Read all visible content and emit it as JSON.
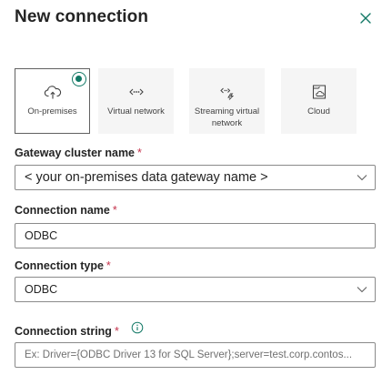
{
  "header": {
    "title": "New connection"
  },
  "tiles": [
    {
      "label": "On-premises",
      "icon": "cloud-upload-icon",
      "selected": true
    },
    {
      "label": "Virtual network",
      "icon": "virtual-network-icon",
      "selected": false
    },
    {
      "label": "Streaming virtual network",
      "icon": "streaming-network-icon",
      "selected": false
    },
    {
      "label": "Cloud",
      "icon": "cloud-report-icon",
      "selected": false
    }
  ],
  "form": {
    "gateway": {
      "label": "Gateway cluster name",
      "required": "*",
      "value": "< your on-premises data gateway name >"
    },
    "connection_name": {
      "label": "Connection name",
      "required": "*",
      "value": "ODBC"
    },
    "connection_type": {
      "label": "Connection type",
      "required": "*",
      "value": "ODBC"
    },
    "connection_string": {
      "label": "Connection string",
      "required": "*",
      "placeholder": "Ex: Driver={ODBC Driver 13 for SQL Server};server=test.corp.contos..."
    }
  },
  "colors": {
    "accent": "#117865",
    "required": "#c4314b",
    "tile_bg": "#f5f5f5"
  }
}
